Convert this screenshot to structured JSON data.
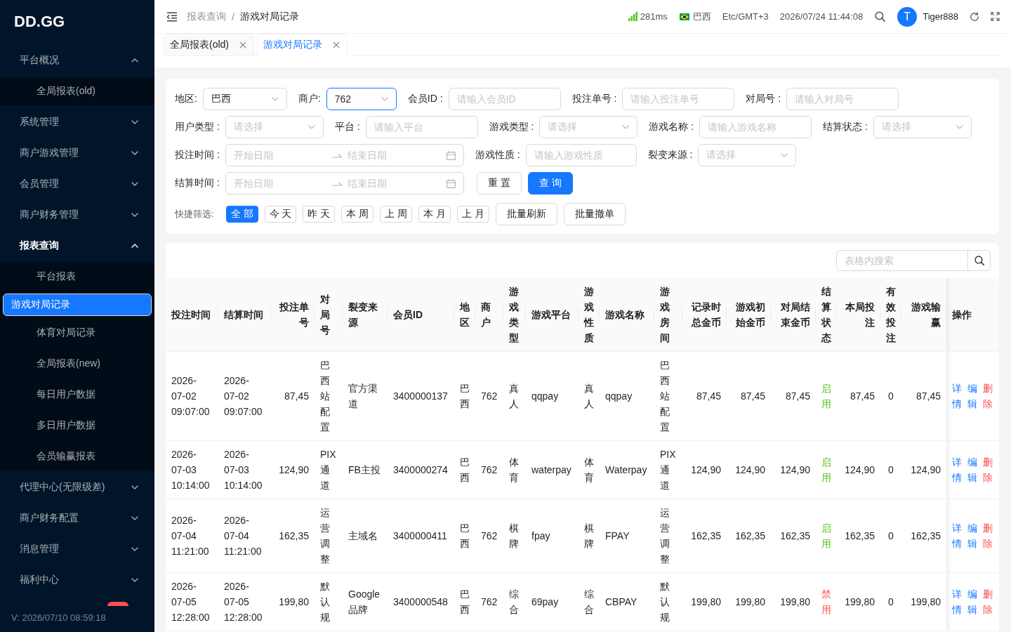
{
  "sidebar": {
    "logo": "DD.GG",
    "items": [
      {
        "label": "平台概况",
        "expanded": true,
        "children": [
          {
            "label": "全局报表(old)",
            "selected": false
          }
        ]
      },
      {
        "label": "系统管理",
        "expanded": false
      },
      {
        "label": "商户游戏管理",
        "expanded": false
      },
      {
        "label": "会员管理",
        "expanded": false
      },
      {
        "label": "商户财务管理",
        "expanded": false
      },
      {
        "label": "报表查询",
        "expanded": true,
        "children": [
          {
            "label": "平台报表",
            "selected": false
          },
          {
            "label": "游戏对局记录",
            "selected": true
          },
          {
            "label": "体育对局记录",
            "selected": false
          },
          {
            "label": "全局报表(new)",
            "selected": false
          },
          {
            "label": "每日用户数据",
            "selected": false
          },
          {
            "label": "多日用户数据",
            "selected": false
          },
          {
            "label": "会员输赢报表",
            "selected": false
          }
        ]
      },
      {
        "label": "代理中心(无限级差)",
        "expanded": false
      },
      {
        "label": "商户财务配置",
        "expanded": false
      },
      {
        "label": "消息管理",
        "expanded": false
      },
      {
        "label": "福利中心",
        "expanded": false
      }
    ],
    "version": "V: 2026/07/10 08:59:18"
  },
  "header": {
    "breadcrumb": [
      "报表查询",
      "游戏对局记录"
    ],
    "breadcrumb_separator": "/",
    "latency": "281ms",
    "region": "巴西",
    "timezone": "Etc/GMT+3",
    "datetime": "2026/07/24 11:44:08",
    "user": {
      "initial": "T",
      "name": "Tiger888"
    }
  },
  "tabs": [
    {
      "label": "全局报表(old)",
      "selected": false
    },
    {
      "label": "游戏对局记录",
      "selected": true
    }
  ],
  "filters": {
    "rows": [
      [
        {
          "label": "地区:",
          "kind": "select",
          "value": "巴西",
          "focused": false
        },
        {
          "label": "商户:",
          "kind": "select",
          "value": "762",
          "focused": true
        },
        {
          "label": "会员ID :",
          "kind": "input",
          "placeholder": "请输入会员ID",
          "focused": false
        },
        {
          "label": "投注单号 :",
          "kind": "input",
          "placeholder": "请输入投注单号",
          "focused": false
        },
        {
          "label": "对局号 :",
          "kind": "input",
          "placeholder": "请输入对局号",
          "focused": false
        }
      ],
      [
        {
          "label": "用户类型 :",
          "kind": "select",
          "placeholder": "请选择",
          "focused": false
        },
        {
          "label": "平台 :",
          "kind": "input",
          "placeholder": "请输入平台",
          "focused": false
        },
        {
          "label": "游戏类型 :",
          "kind": "select",
          "placeholder": "请选择",
          "focused": false
        },
        {
          "label": "游戏名称 :",
          "kind": "input",
          "placeholder": "请输入游戏名称",
          "focused": false
        },
        {
          "label": "结算状态 :",
          "kind": "select",
          "placeholder": "请选择",
          "focused": false
        }
      ],
      [
        {
          "label": "投注时间 :",
          "kind": "range",
          "start_placeholder": "开始日期",
          "end_placeholder": "结束日期",
          "focused": false
        },
        {
          "label": "游戏性质 :",
          "kind": "input",
          "placeholder": "请输入游戏性质",
          "focused": false
        },
        {
          "label": "裂变来源 :",
          "kind": "select",
          "placeholder": "请选择",
          "focused": false
        }
      ],
      [
        {
          "label": "结算时间 :",
          "kind": "range",
          "start_placeholder": "开始日期",
          "end_placeholder": "结束日期",
          "focused": false
        },
        {
          "kind": "button",
          "label": "重 置",
          "primary": false
        },
        {
          "kind": "button",
          "label": "查 询",
          "primary": true
        }
      ]
    ],
    "quick": {
      "label": "快捷筛选:",
      "options": [
        {
          "label": "全 部",
          "selected": true
        },
        {
          "label": "今 天",
          "selected": false
        },
        {
          "label": "昨 天",
          "selected": false
        },
        {
          "label": "本 周",
          "selected": false
        },
        {
          "label": "上 周",
          "selected": false
        },
        {
          "label": "本 月",
          "selected": false
        },
        {
          "label": "上 月",
          "selected": false
        }
      ],
      "actions": [
        "批量刷新",
        "批量撤单"
      ]
    }
  },
  "table": {
    "search_placeholder": "表格内搜索",
    "columns": [
      "投注时间",
      "结算时间",
      "投注单号",
      "对局号",
      "裂变来源",
      "会员ID",
      "地区",
      "商户",
      "游戏类型",
      "游戏平台",
      "游戏性质",
      "游戏名称",
      "游戏房间",
      "记录时总金币",
      "游戏初始金币",
      "对局结束金币",
      "结算状态",
      "本局投注",
      "有效投注",
      "游戏输赢",
      "操作"
    ],
    "rows": [
      {
        "cells": [
          "2026-07-02 09:07:00",
          "2026-07-02 09:07:00",
          "87,45",
          "巴西站配置",
          "官方渠道",
          "3400000137",
          "巴西",
          "762",
          "真人",
          "qqpay",
          "真人",
          "qqpay",
          "巴西站配置",
          "87,45",
          "87,45",
          "87,45",
          {
            "text": "启用",
            "color": "#52c41a"
          },
          "87,45",
          "0",
          "87,45"
        ],
        "actions": [
          {
            "label": "详情",
            "kind": "link"
          },
          {
            "label": "编辑",
            "kind": "link"
          },
          {
            "label": "删除",
            "kind": "danger"
          }
        ]
      },
      {
        "cells": [
          "2026-07-03 10:14:00",
          "2026-07-03 10:14:00",
          "124,90",
          "PIX通道",
          "FB主投",
          "3400000274",
          "巴西",
          "762",
          "体育",
          "waterpay",
          "体育",
          "Waterpay",
          "PIX通道",
          "124,90",
          "124,90",
          "124,90",
          {
            "text": "启用",
            "color": "#52c41a"
          },
          "124,90",
          "0",
          "124,90"
        ],
        "actions": [
          {
            "label": "详情",
            "kind": "link"
          },
          {
            "label": "编辑",
            "kind": "link"
          },
          {
            "label": "删除",
            "kind": "danger"
          }
        ]
      },
      {
        "cells": [
          "2026-07-04 11:21:00",
          "2026-07-04 11:21:00",
          "162,35",
          "运营调整",
          "主域名",
          "3400000411",
          "巴西",
          "762",
          "棋牌",
          "fpay",
          "棋牌",
          "FPAY",
          "运营调整",
          "162,35",
          "162,35",
          "162,35",
          {
            "text": "启用",
            "color": "#52c41a"
          },
          "162,35",
          "0",
          "162,35"
        ],
        "actions": [
          {
            "label": "详情",
            "kind": "link"
          },
          {
            "label": "编辑",
            "kind": "link"
          },
          {
            "label": "删除",
            "kind": "danger"
          }
        ]
      },
      {
        "cells": [
          "2026-07-05 12:28:00",
          "2026-07-05 12:28:00",
          "199,80",
          "默认规",
          "Google品牌",
          "3400000548",
          "巴西",
          "762",
          "综合",
          "69pay",
          "综合",
          "CBPAY",
          "默认规",
          "199,80",
          "199,80",
          "199,80",
          {
            "text": "禁用",
            "color": "#ff4d4f"
          },
          "199,80",
          "0",
          "199,80"
        ],
        "actions": [
          {
            "label": "详情",
            "kind": "link"
          },
          {
            "label": "编辑",
            "kind": "link"
          },
          {
            "label": "删除",
            "kind": "danger"
          }
        ]
      }
    ]
  }
}
